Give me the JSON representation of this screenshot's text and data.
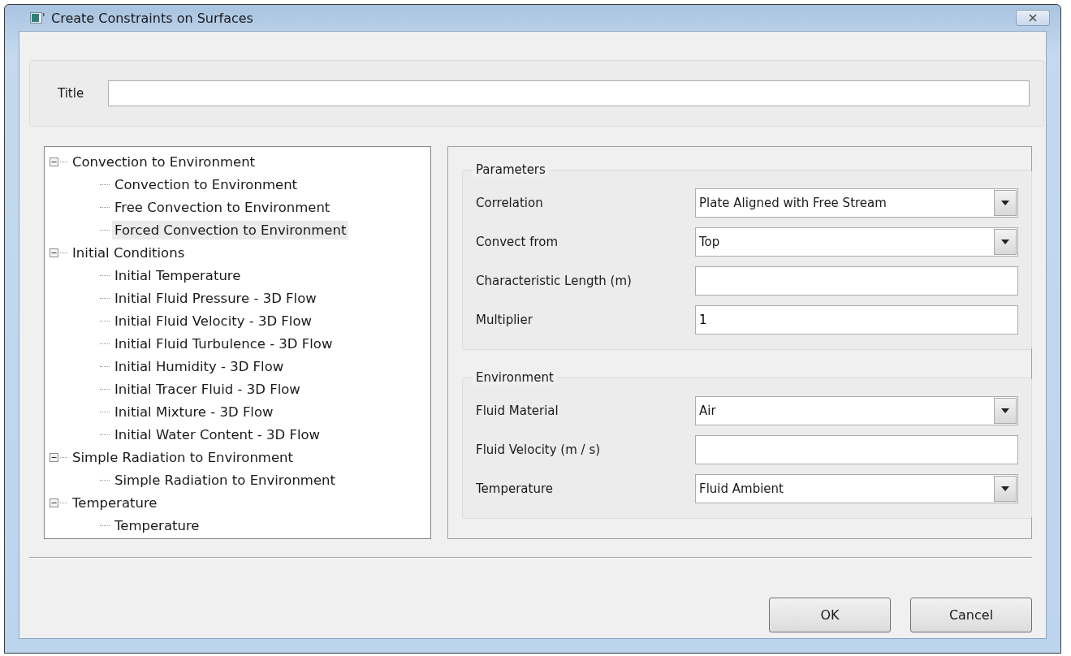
{
  "window": {
    "title": "Create Constraints on Surfaces"
  },
  "title_field": {
    "label": "Title"
  },
  "tree": [
    {
      "label": "Convection to Environment",
      "expanded": true,
      "selected": false,
      "children": [
        {
          "label": "Convection to Environment",
          "selected": false
        },
        {
          "label": "Free Convection to Environment",
          "selected": false
        },
        {
          "label": "Forced Convection to Environment",
          "selected": true
        }
      ]
    },
    {
      "label": "Initial Conditions",
      "expanded": true,
      "selected": false,
      "children": [
        {
          "label": "Initial Temperature",
          "selected": false
        },
        {
          "label": "Initial Fluid Pressure - 3D Flow",
          "selected": false
        },
        {
          "label": "Initial Fluid Velocity - 3D Flow",
          "selected": false
        },
        {
          "label": "Initial Fluid Turbulence - 3D Flow",
          "selected": false
        },
        {
          "label": "Initial Humidity - 3D Flow",
          "selected": false
        },
        {
          "label": "Initial Tracer Fluid - 3D Flow",
          "selected": false
        },
        {
          "label": "Initial Mixture - 3D Flow",
          "selected": false
        },
        {
          "label": "Initial Water Content - 3D Flow",
          "selected": false
        }
      ]
    },
    {
      "label": "Simple Radiation to Environment",
      "expanded": true,
      "selected": false,
      "children": [
        {
          "label": "Simple Radiation to Environment",
          "selected": false
        }
      ]
    },
    {
      "label": "Temperature",
      "expanded": true,
      "selected": false,
      "children": [
        {
          "label": "Temperature",
          "selected": false
        }
      ]
    }
  ],
  "groups": [
    {
      "title": "Parameters",
      "fields": [
        {
          "label": "Correlation",
          "kind": "dropdown",
          "value": "Plate Aligned with Free Stream"
        },
        {
          "label": "Convect from",
          "kind": "dropdown",
          "value": "Top"
        },
        {
          "label": "Characteristic Length (m)",
          "kind": "text"
        },
        {
          "label": "Multiplier",
          "kind": "text",
          "value": "1"
        }
      ]
    },
    {
      "title": "Environment",
      "fields": [
        {
          "label": "Fluid Material",
          "kind": "dropdown",
          "value": "Air"
        },
        {
          "label": "Fluid Velocity (m / s)",
          "kind": "text"
        },
        {
          "label": "Temperature",
          "kind": "dropdown",
          "value": "Fluid Ambient"
        }
      ]
    }
  ],
  "buttons": [
    "OK",
    "Cancel"
  ]
}
